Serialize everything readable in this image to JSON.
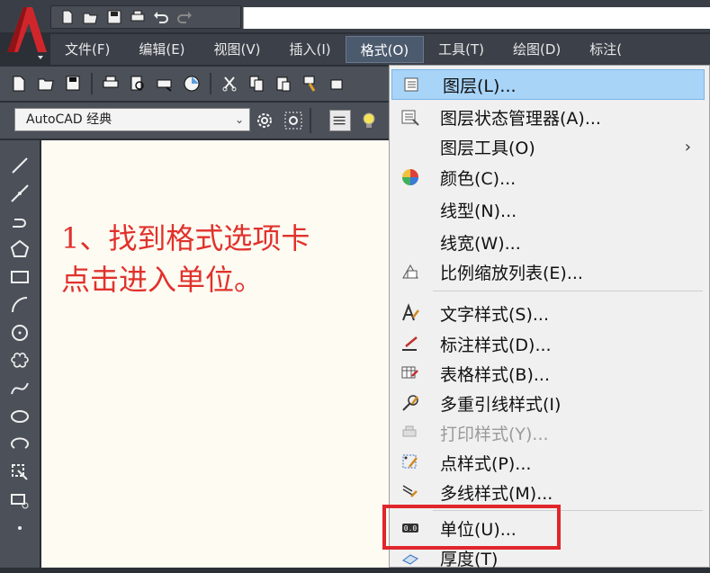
{
  "menubar": {
    "items": [
      {
        "label": "文件(F)"
      },
      {
        "label": "编辑(E)"
      },
      {
        "label": "视图(V)"
      },
      {
        "label": "插入(I)"
      },
      {
        "label": "格式(O)"
      },
      {
        "label": "工具(T)"
      },
      {
        "label": "绘图(D)"
      },
      {
        "label": "标注("
      }
    ]
  },
  "workspace": {
    "value": "AutoCAD 经典"
  },
  "annotation": {
    "text": "1、找到格式选项卡\n点击进入单位。",
    "color": "#e1312c"
  },
  "format_menu": {
    "items": [
      {
        "label": "图层(L)...",
        "icon": "layer-icon"
      },
      {
        "label": "图层状态管理器(A)...",
        "icon": "layer-state-icon"
      },
      {
        "label": "图层工具(O)",
        "submenu_arrow": "›"
      },
      {
        "label": "颜色(C)...",
        "icon": "color-wheel-icon"
      },
      {
        "label": "线型(N)..."
      },
      {
        "label": "线宽(W)..."
      },
      {
        "label": "比例缩放列表(E)...",
        "icon": "scale-list-icon"
      },
      {
        "label": "文字样式(S)...",
        "icon": "text-style-icon"
      },
      {
        "label": "标注样式(D)...",
        "icon": "dim-style-icon"
      },
      {
        "label": "表格样式(B)...",
        "icon": "table-style-icon"
      },
      {
        "label": "多重引线样式(I)",
        "icon": "mleader-style-icon"
      },
      {
        "label": "打印样式(Y)...",
        "icon": "plot-style-icon"
      },
      {
        "label": "点样式(P)...",
        "icon": "point-style-icon"
      },
      {
        "label": "多线样式(M)...",
        "icon": "mline-style-icon"
      },
      {
        "label": "单位(U)...",
        "icon": "units-icon"
      },
      {
        "label": "厚度(T)",
        "icon": "thickness-icon"
      }
    ]
  },
  "colors": {
    "highlight": "#a8d4f8",
    "callout_box": "#e0262b",
    "logo": "#d0262b"
  }
}
